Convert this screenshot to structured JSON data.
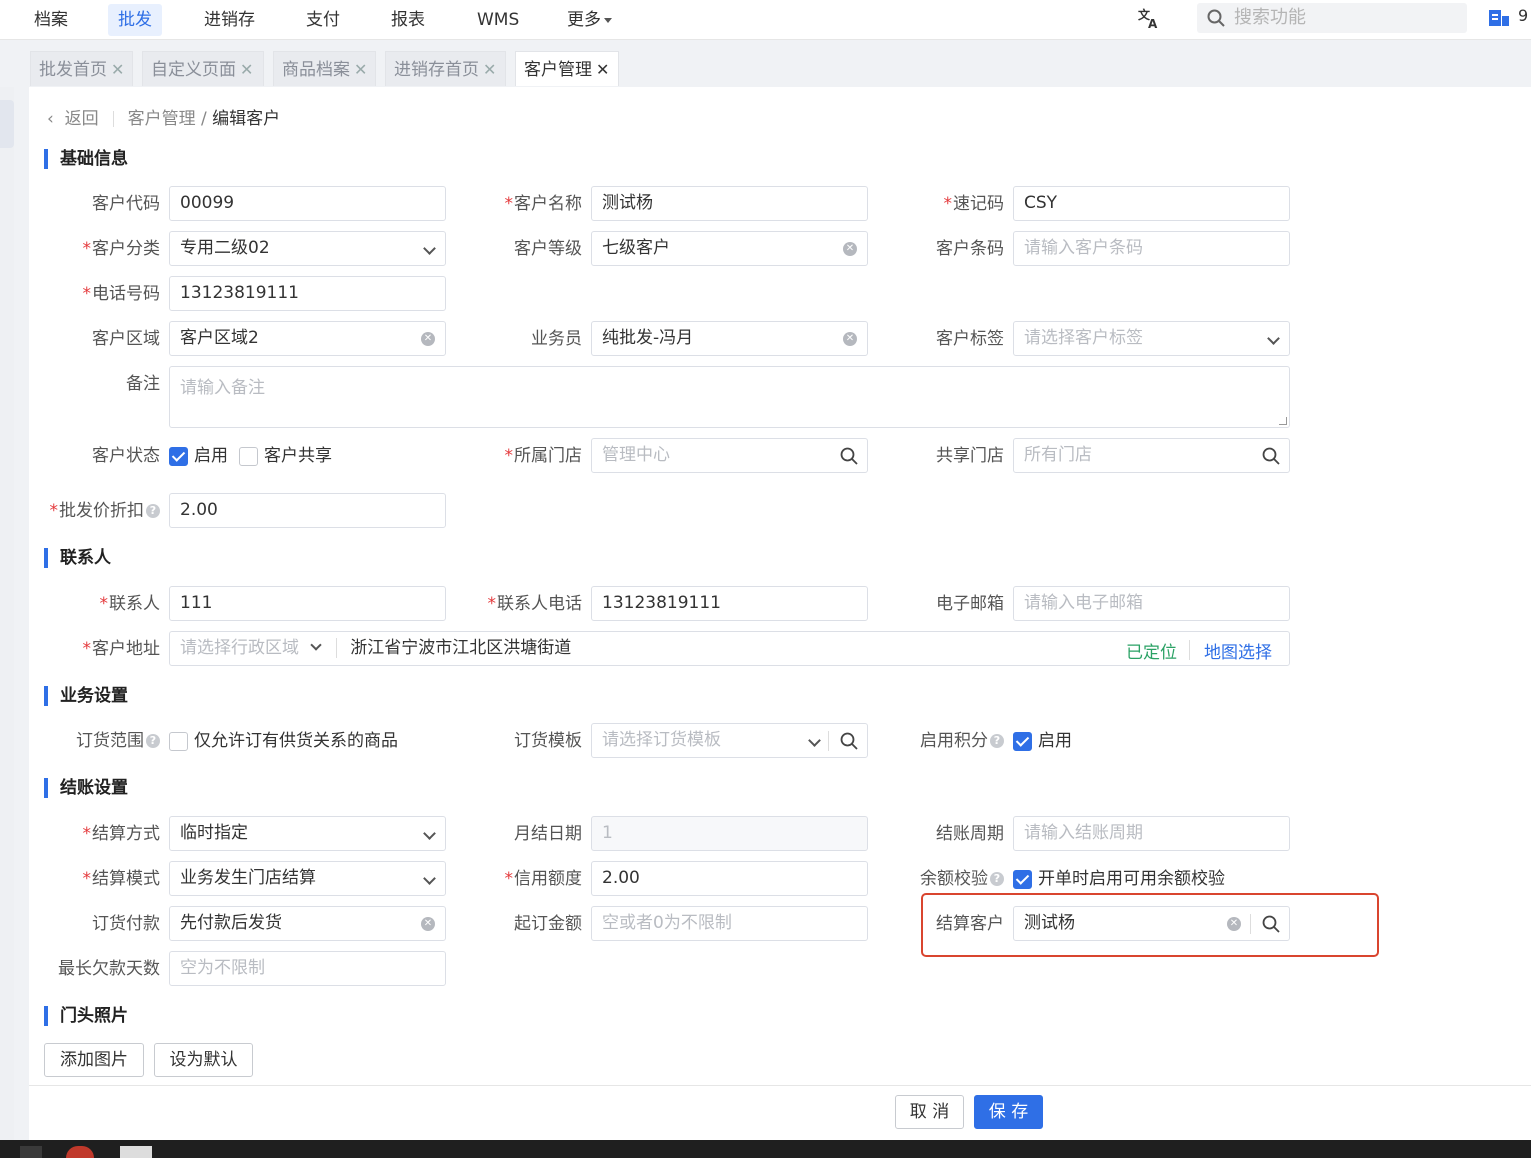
{
  "topnav": {
    "items": [
      "档案",
      "批发",
      "进销存",
      "支付",
      "报表",
      "WMS",
      "更多"
    ],
    "search_placeholder": "搜索功能",
    "user_num": "9"
  },
  "tabs": [
    "批发首页",
    "自定义页面",
    "商品档案",
    "进销存首页",
    "客户管理"
  ],
  "breadcrumb": {
    "back": "返回",
    "parent": "客户管理",
    "slash": "/",
    "current": "编辑客户"
  },
  "sections": {
    "basic": "基础信息",
    "contact": "联系人",
    "business": "业务设置",
    "settle": "结账设置",
    "photo": "门头照片"
  },
  "basic": {
    "code_label": "客户代码",
    "code_value": "00099",
    "name_label": "客户名称",
    "name_value": "测试杨",
    "shortcode_label": "速记码",
    "shortcode_value": "CSY",
    "category_label": "客户分类",
    "category_value": "专用二级02",
    "level_label": "客户等级",
    "level_value": "七级客户",
    "barcode_label": "客户条码",
    "barcode_placeholder": "请输入客户条码",
    "phone_label": "电话号码",
    "phone_value": "13123819111",
    "region_label": "客户区域",
    "region_value": "客户区域2",
    "salesman_label": "业务员",
    "salesman_value": "纯批发-冯月",
    "tag_label": "客户标签",
    "tag_placeholder": "请选择客户标签",
    "remark_label": "备注",
    "remark_placeholder": "请输入备注",
    "status_label": "客户状态",
    "status_enabled": "启用",
    "status_shared": "客户共享",
    "store_label": "所属门店",
    "store_placeholder": "管理中心",
    "share_store_label": "共享门店",
    "share_store_placeholder": "所有门店",
    "discount_label": "批发价折扣",
    "discount_value": "2.00"
  },
  "contact": {
    "person_label": "联系人",
    "person_value": "111",
    "phone_label": "联系人电话",
    "phone_value": "13123819111",
    "email_label": "电子邮箱",
    "email_placeholder": "请输入电子邮箱",
    "address_label": "客户地址",
    "area_placeholder": "请选择行政区域",
    "address_value": "浙江省宁波市江北区洪塘街道",
    "located": "已定位",
    "map_select": "地图选择"
  },
  "business": {
    "scope_label": "订货范围",
    "scope_text": "仅允许订有供货关系的商品",
    "template_label": "订货模板",
    "template_placeholder": "请选择订货模板",
    "points_label": "启用积分",
    "points_text": "启用"
  },
  "settle": {
    "method_label": "结算方式",
    "method_value": "临时指定",
    "monthly_label": "月结日期",
    "monthly_value": "1",
    "period_label": "结账周期",
    "period_placeholder": "请输入结账周期",
    "mode_label": "结算模式",
    "mode_value": "业务发生门店结算",
    "credit_label": "信用额度",
    "credit_value": "2.00",
    "balance_label": "余额校验",
    "balance_text": "开单时启用可用余额校验",
    "payment_label": "订货付款",
    "payment_value": "先付款后发货",
    "min_order_label": "起订金额",
    "min_order_placeholder": "空或者0为不限制",
    "settle_customer_label": "结算客户",
    "settle_customer_value": "测试杨",
    "max_days_label": "最长欠款天数",
    "max_days_placeholder": "空为不限制"
  },
  "photo": {
    "add": "添加图片",
    "default": "设为默认"
  },
  "footer": {
    "cancel": "取 消",
    "save": "保 存"
  },
  "colors": {
    "accent": "#2f6fe6",
    "required": "#e4393c",
    "highlight": "#d9452f",
    "located": "#2ba265"
  }
}
